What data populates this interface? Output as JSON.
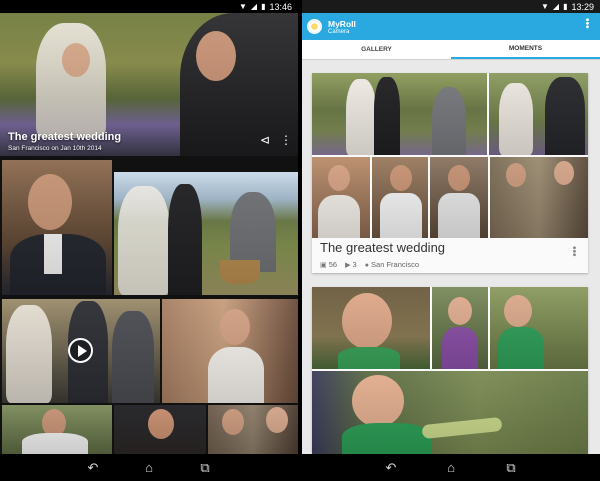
{
  "left": {
    "status_time": "13:46",
    "status_icons": [
      "wifi-icon",
      "signal-icon",
      "battery-icon"
    ],
    "hero_title": "The greatest wedding",
    "hero_subtitle": "San Francisco on Jan 10th 2014",
    "hero_actions": [
      "share-icon",
      "overflow-menu-icon"
    ],
    "nav": [
      "back-icon",
      "home-icon",
      "recents-icon"
    ]
  },
  "right": {
    "status_time": "13:29",
    "app_title": "MyRoll",
    "app_subtitle": "Camera",
    "tabs": [
      {
        "label": "GALLERY",
        "active": false
      },
      {
        "label": "MOMENTS",
        "active": true
      }
    ],
    "card": {
      "title": "The greatest wedding",
      "photos_count": "56",
      "videos_count": "3",
      "location": "San Francisco"
    },
    "nav": [
      "back-icon",
      "home-icon",
      "recents-icon"
    ]
  },
  "colors": {
    "accent": "#29a9e0",
    "tab_indicator": "#29a9e0"
  }
}
